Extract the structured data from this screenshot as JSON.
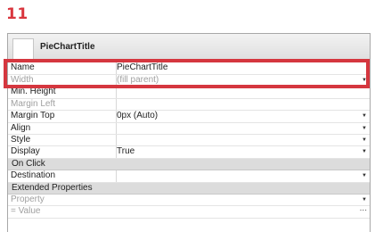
{
  "step_number": "11",
  "panel": {
    "title": "PieChartTitle"
  },
  "properties": [
    {
      "label": "Name",
      "value": "PieChartTitle",
      "dim": false,
      "dropdown": false
    },
    {
      "label": "Width",
      "value": "(fill parent)",
      "dim": true,
      "dropdown": true
    },
    {
      "label": "Min. Height",
      "value": "",
      "dim": false,
      "dropdown": false
    },
    {
      "label": "Margin Left",
      "value": "",
      "dim": true,
      "dropdown": false
    },
    {
      "label": "Margin Top",
      "value": "0px (Auto)",
      "dim": false,
      "dropdown": true
    },
    {
      "label": "Align",
      "value": "",
      "dim": false,
      "dropdown": true
    },
    {
      "label": "Style",
      "value": "",
      "dim": false,
      "dropdown": true
    },
    {
      "label": "Display",
      "value": "True",
      "dim": false,
      "dropdown": true
    }
  ],
  "on_click": {
    "section_label": "On Click",
    "destination_label": "Destination",
    "destination_value": ""
  },
  "extended": {
    "section_label": "Extended Properties",
    "property_label": "Property",
    "value_label": "= Value",
    "more_glyph": "..."
  },
  "colors": {
    "accent": "#d9363e",
    "highlight_border": "#d5373f",
    "section_bg": "#dcdcdc"
  }
}
